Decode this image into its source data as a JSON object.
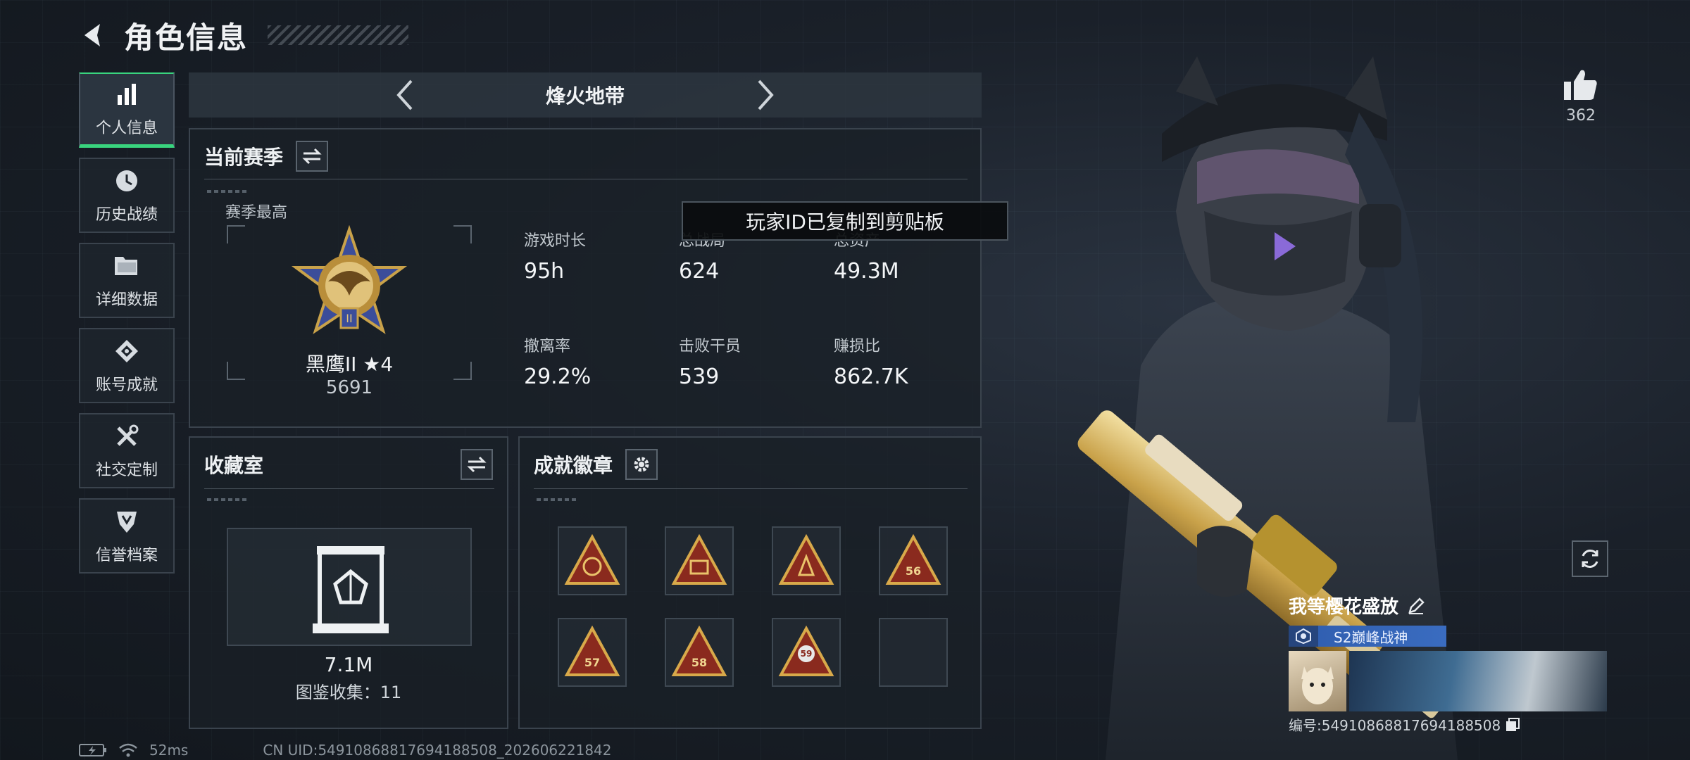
{
  "header": {
    "title": "角色信息"
  },
  "sidebar": {
    "items": [
      {
        "label": "个人信息",
        "icon": "bar-chart-icon",
        "active": true
      },
      {
        "label": "历史战绩",
        "icon": "history-icon"
      },
      {
        "label": "详细数据",
        "icon": "folder-icon"
      },
      {
        "label": "账号成就",
        "icon": "achievement-icon"
      },
      {
        "label": "社交定制",
        "icon": "tools-icon"
      },
      {
        "label": "信誉档案",
        "icon": "reputation-icon"
      }
    ]
  },
  "mode": {
    "name": "烽火地带"
  },
  "season": {
    "title": "当前赛季",
    "best_label": "赛季最高",
    "rank_name": "黑鹰II ★4",
    "rank_score": "5691",
    "stats": [
      {
        "label": "游戏时长",
        "value": "95h"
      },
      {
        "label": "总战局",
        "value": "624"
      },
      {
        "label": "总资产",
        "value": "49.3M"
      },
      {
        "label": "撤离率",
        "value": "29.2%"
      },
      {
        "label": "击败干员",
        "value": "539"
      },
      {
        "label": "赚损比",
        "value": "862.7K"
      }
    ]
  },
  "toast": {
    "text": "玩家ID已复制到剪贴板"
  },
  "collection": {
    "title": "收藏室",
    "value": "7.1M",
    "count_text": "图鉴收集：11"
  },
  "badges": {
    "title": "成就徽章",
    "numbers": [
      "",
      "",
      "",
      "56",
      "57",
      "58",
      "59",
      ""
    ]
  },
  "likes": {
    "count": "362"
  },
  "player": {
    "name": "我等樱花盛放",
    "title": "S2巅峰战神",
    "id_text": "编号:5491086881769418850​8"
  },
  "status": {
    "ping": "52ms",
    "uid": "CN UID:54910868817694188508_202606221842"
  },
  "colors": {
    "accent": "#39d47e",
    "title_bar": "#3a6cc0",
    "gold": "#c9a24a"
  }
}
